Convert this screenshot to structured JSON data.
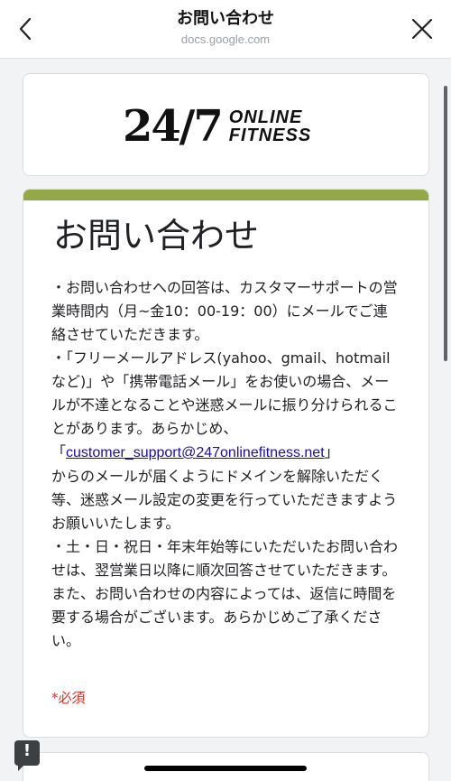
{
  "header": {
    "title": "お問い合わせ",
    "url": "docs.google.com",
    "back_icon": "chevron-left",
    "close_icon": "close-x"
  },
  "logo": {
    "number": "24/7",
    "line1": "ONLINE",
    "line2": "FITNESS"
  },
  "form": {
    "accent_color": "#95a849",
    "heading": "お問い合わせ",
    "paragraphs": [
      "・お問い合わせへの回答は、カスタマーサポートの営業時間内（月~金10：00-19：00）にメールでご連絡させていただきます。",
      "・「フリーメールアドレス(yahoo、gmail、hotmailなど)」や「携帯電話メール」をお使いの場合、メールが不達となることや迷惑メールに振り分けられることがあります。あらかじめ、",
      "からのメールが届くようにドメインを解除いただく等、迷惑メール設定の変更を行っていただきますようお願いいたします。",
      "・土・日・祝日・年末年始等にいただいたお問い合わせは、翌営業日以降に順次回答させていただきます。また、お問い合わせの内容によっては、返信に時間を要する場合がございます。あらかじめご了承ください。"
    ],
    "email_open": "「",
    "email": "customer_support@247onlinefitness.net",
    "email_close": "」",
    "required_note": "*必須"
  },
  "feedback_icon": "report-exclamation"
}
